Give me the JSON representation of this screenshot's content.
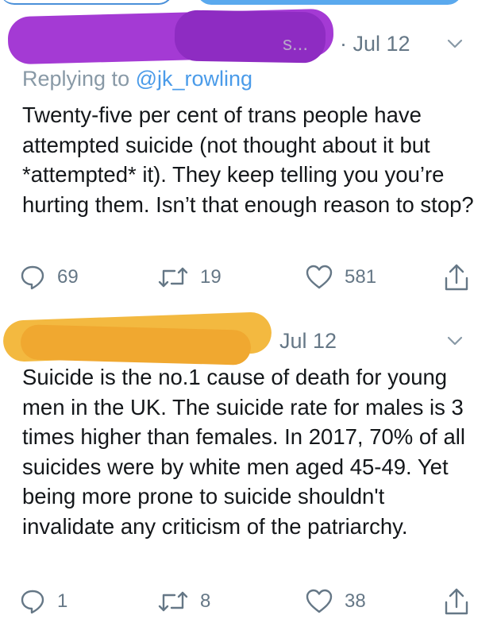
{
  "tweets": [
    {
      "handle_fragment": "s...",
      "date": "· Jul 12",
      "replying_prefix": "Replying to ",
      "replying_handle": "@jk_rowling",
      "text": "Twenty-five per cent of trans people have attempted suicide (not thought about it but *attempted* it). They keep telling you you’re hurting them. Isn’t that enough reason to stop?",
      "replies": "69",
      "retweets": "19",
      "likes": "581",
      "redaction_color": "#a43ad4"
    },
    {
      "date": "Jul 12",
      "text": "Suicide is the no.1 cause of death for young men in the UK. The suicide rate for males is 3 times higher than females. In 2017, 70% of all suicides were by white men aged 45-49. Yet being more prone to suicide shouldn't invalidate any criticism of the patriarchy.",
      "replies": "1",
      "retweets": "8",
      "likes": "38",
      "redaction_color": "#f3b940"
    }
  ],
  "icons": {
    "reply": "reply-icon",
    "retweet": "retweet-icon",
    "like": "heart-icon",
    "share": "share-icon",
    "menu": "chevron-down-icon"
  },
  "colors": {
    "text": "#14171a",
    "muted": "#657786",
    "link": "#4a9be9"
  }
}
